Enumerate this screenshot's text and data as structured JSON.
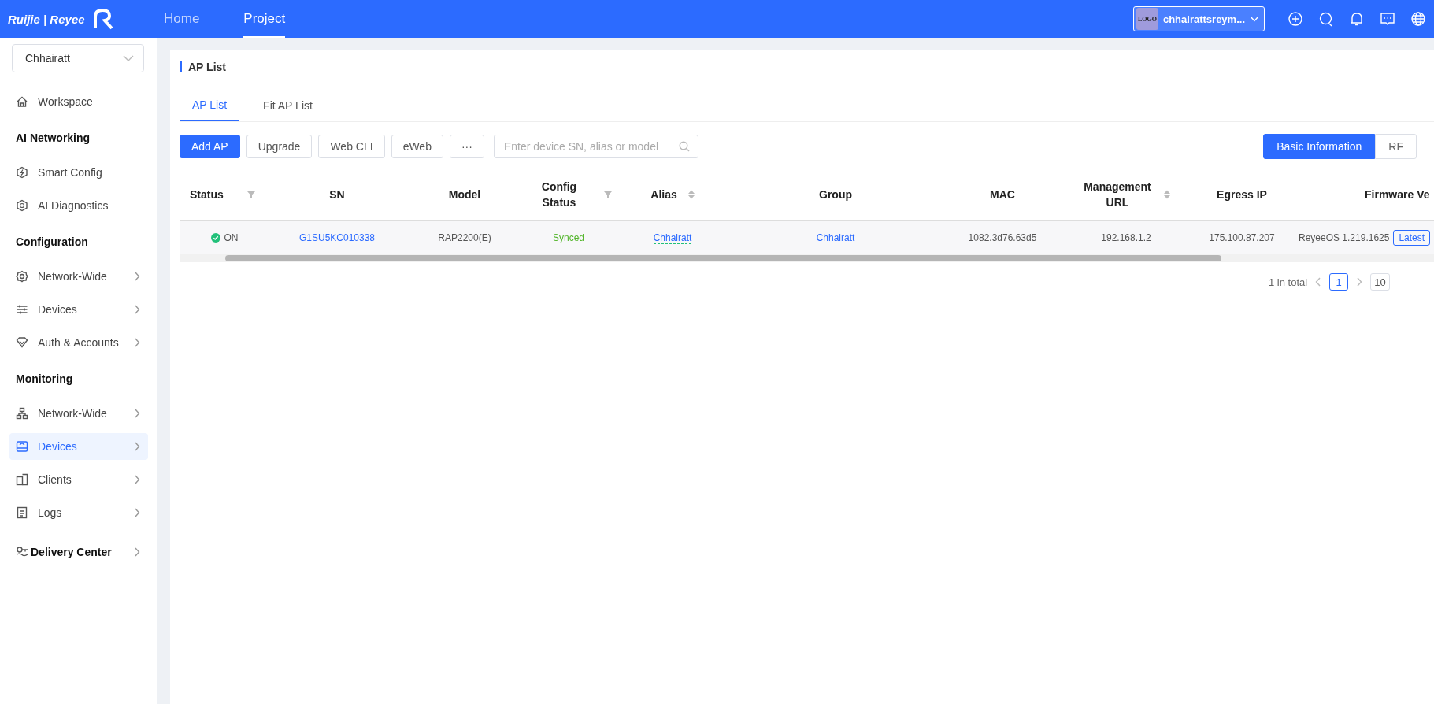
{
  "topbar": {
    "brand": "Ruijie | Reyee",
    "nav": [
      {
        "label": "Home",
        "selected": false
      },
      {
        "label": "Project",
        "selected": true
      }
    ],
    "account": {
      "logo": "LOGO",
      "name": "chhairattsreym..."
    }
  },
  "sidebar": {
    "project": "Chhairatt",
    "sections": [
      {
        "items": [
          {
            "label": "Workspace",
            "chevron": false,
            "selected": false
          }
        ]
      },
      {
        "title": "AI Networking",
        "items": [
          {
            "label": "Smart Config",
            "chevron": false,
            "selected": false
          },
          {
            "label": "AI Diagnostics",
            "chevron": false,
            "selected": false
          }
        ]
      },
      {
        "title": "Configuration",
        "items": [
          {
            "label": "Network-Wide",
            "chevron": true,
            "selected": false
          },
          {
            "label": "Devices",
            "chevron": true,
            "selected": false
          },
          {
            "label": "Auth & Accounts",
            "chevron": true,
            "selected": false
          }
        ]
      },
      {
        "title": "Monitoring",
        "items": [
          {
            "label": "Network-Wide",
            "chevron": true,
            "selected": false
          },
          {
            "label": "Devices",
            "chevron": true,
            "selected": true
          },
          {
            "label": "Clients",
            "chevron": true,
            "selected": false
          },
          {
            "label": "Logs",
            "chevron": true,
            "selected": false
          }
        ]
      }
    ],
    "footer": {
      "label": "Delivery Center",
      "chevron": true
    }
  },
  "page": {
    "title": "AP List",
    "tabs": [
      {
        "label": "AP List",
        "selected": true
      },
      {
        "label": "Fit AP List",
        "selected": false
      }
    ],
    "actions": [
      {
        "label": "Add AP",
        "kind": "primary"
      },
      {
        "label": "Upgrade",
        "kind": "default"
      },
      {
        "label": "Web CLI",
        "kind": "default"
      },
      {
        "label": "eWeb",
        "kind": "default"
      },
      {
        "label": "···",
        "kind": "default"
      }
    ],
    "search": {
      "placeholder": "Enter device SN, alias or model"
    },
    "views": [
      {
        "label": "Basic Information",
        "selected": true
      },
      {
        "label": "RF",
        "selected": false
      }
    ],
    "table": {
      "columns": [
        {
          "label": "Status",
          "kind": "filter"
        },
        {
          "label": "SN",
          "kind": "plain"
        },
        {
          "label": "Model",
          "kind": "plain"
        },
        {
          "label": "Config Status",
          "kind": "filter"
        },
        {
          "label": "Alias",
          "kind": "sort"
        },
        {
          "label": "Group",
          "kind": "plain"
        },
        {
          "label": "MAC",
          "kind": "plain"
        },
        {
          "label": "Management URL",
          "kind": "sort"
        },
        {
          "label": "Egress IP",
          "kind": "plain"
        },
        {
          "label": "Firmware Ve",
          "kind": "plain"
        }
      ],
      "rows": [
        {
          "status": "ON",
          "online": true,
          "sn": "G1SU5KC010338",
          "model": "RAP2200(E)",
          "config_status": "Synced",
          "alias": "Chhairatt",
          "group": "Chhairatt",
          "mac": "1082.3d76.63d5",
          "management_url": "192.168.1.2",
          "egress_ip": "175.100.87.207",
          "firmware": "ReyeeOS 1.219.1625",
          "firmware_badge": "Latest"
        }
      ]
    },
    "pagination": {
      "total": "1 in total",
      "pages": [
        {
          "label": "1",
          "selected": true
        }
      ],
      "page_size": "10"
    }
  }
}
